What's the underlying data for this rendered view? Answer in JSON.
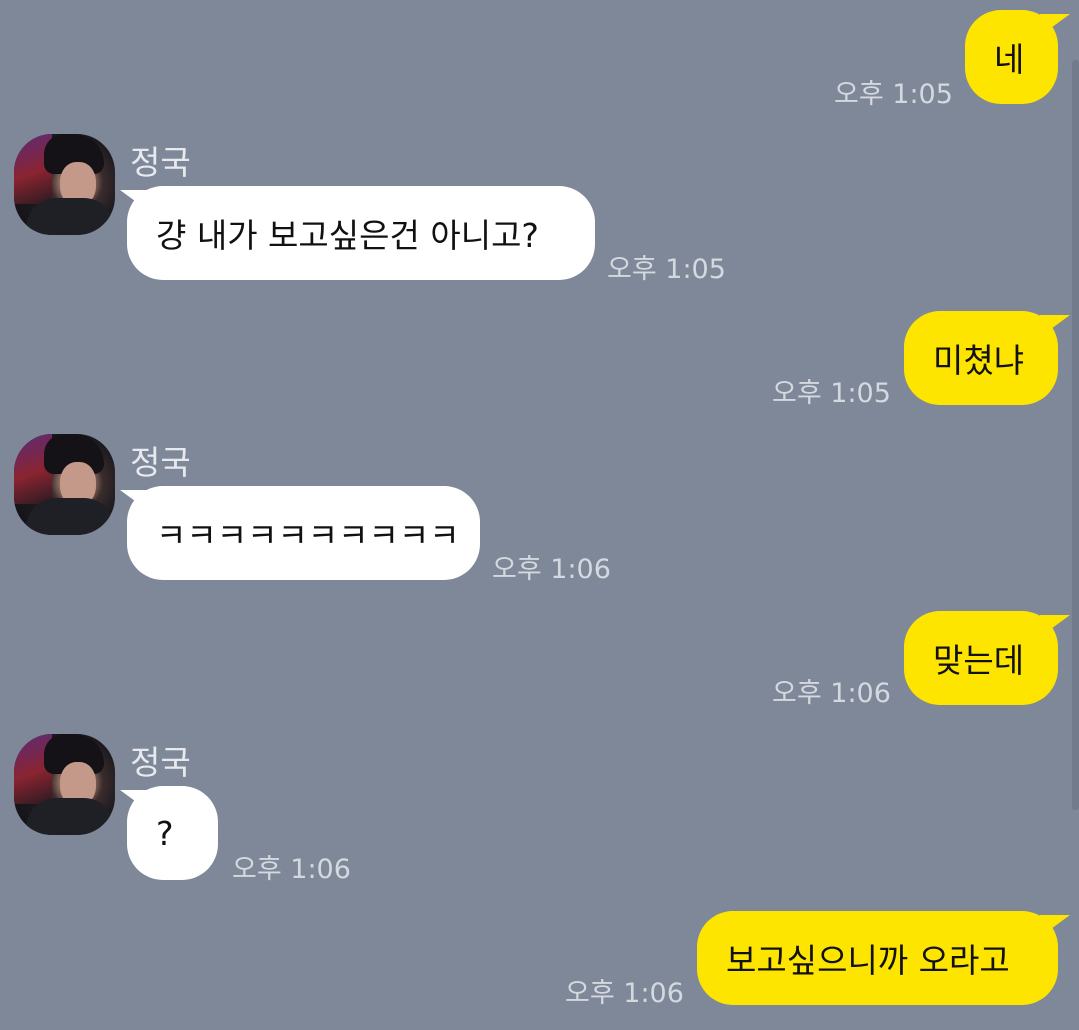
{
  "messages": [
    {
      "sender": "me",
      "text": "네",
      "time": "오후 1:05"
    },
    {
      "sender": "정국",
      "text": "걍 내가 보고싶은건 아니고?",
      "time": "오후 1:05"
    },
    {
      "sender": "me",
      "text": "미쳤냐",
      "time": "오후 1:05"
    },
    {
      "sender": "정국",
      "text": "ㅋㅋㅋㅋㅋㅋㅋㅋㅋㅋ",
      "time": "오후 1:06"
    },
    {
      "sender": "me",
      "text": "맞는데",
      "time": "오후 1:06"
    },
    {
      "sender": "정국",
      "text": "?",
      "time": "오후 1:06"
    },
    {
      "sender": "me",
      "text": "보고싶으니까 오라고",
      "time": "오후 1:06"
    }
  ],
  "colors": {
    "background": "#7e8899",
    "my_bubble": "#fee500",
    "their_bubble": "#ffffff",
    "timestamp": "#d4d8df",
    "name": "#e7e9ee"
  },
  "icons": {
    "avatar": "profile-photo"
  }
}
